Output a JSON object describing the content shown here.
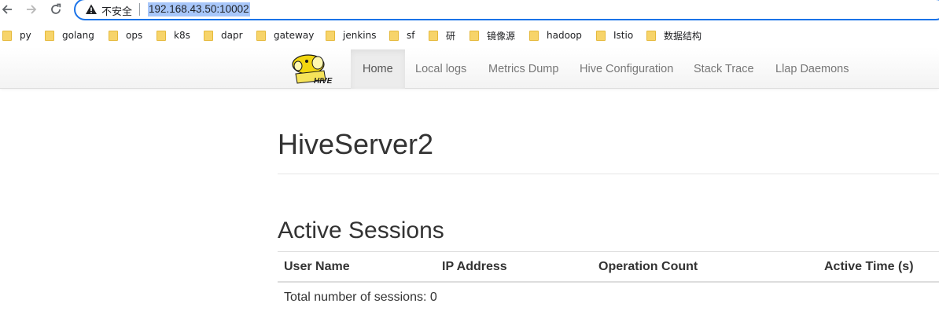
{
  "browser": {
    "back_icon": "arrow-left-icon",
    "forward_icon": "arrow-right-icon",
    "reload_icon": "reload-icon",
    "security_label": "不安全",
    "url": "192.168.43.50:10002",
    "accent_color": "#1a73e8",
    "url_highlight_color": "#a8c7fa"
  },
  "bookmarks": [
    {
      "label": "py"
    },
    {
      "label": "golang"
    },
    {
      "label": "ops"
    },
    {
      "label": "k8s"
    },
    {
      "label": "dapr"
    },
    {
      "label": "gateway"
    },
    {
      "label": "jenkins"
    },
    {
      "label": "sf"
    },
    {
      "label": "研"
    },
    {
      "label": "镜像源"
    },
    {
      "label": "hadoop"
    },
    {
      "label": "Istio"
    },
    {
      "label": "数据结构"
    }
  ],
  "navbar": {
    "logo_text": "HIVE",
    "items": [
      {
        "label": "Home",
        "active": true
      },
      {
        "label": "Local logs"
      },
      {
        "label": "Metrics Dump"
      },
      {
        "label": "Hive Configuration"
      },
      {
        "label": "Stack Trace"
      },
      {
        "label": "Llap Daemons"
      }
    ]
  },
  "main": {
    "title": "HiveServer2",
    "sessions": {
      "title": "Active Sessions",
      "columns": [
        "User Name",
        "IP Address",
        "Operation Count",
        "Active Time (s)"
      ],
      "total_text": "Total number of sessions: 0"
    }
  }
}
